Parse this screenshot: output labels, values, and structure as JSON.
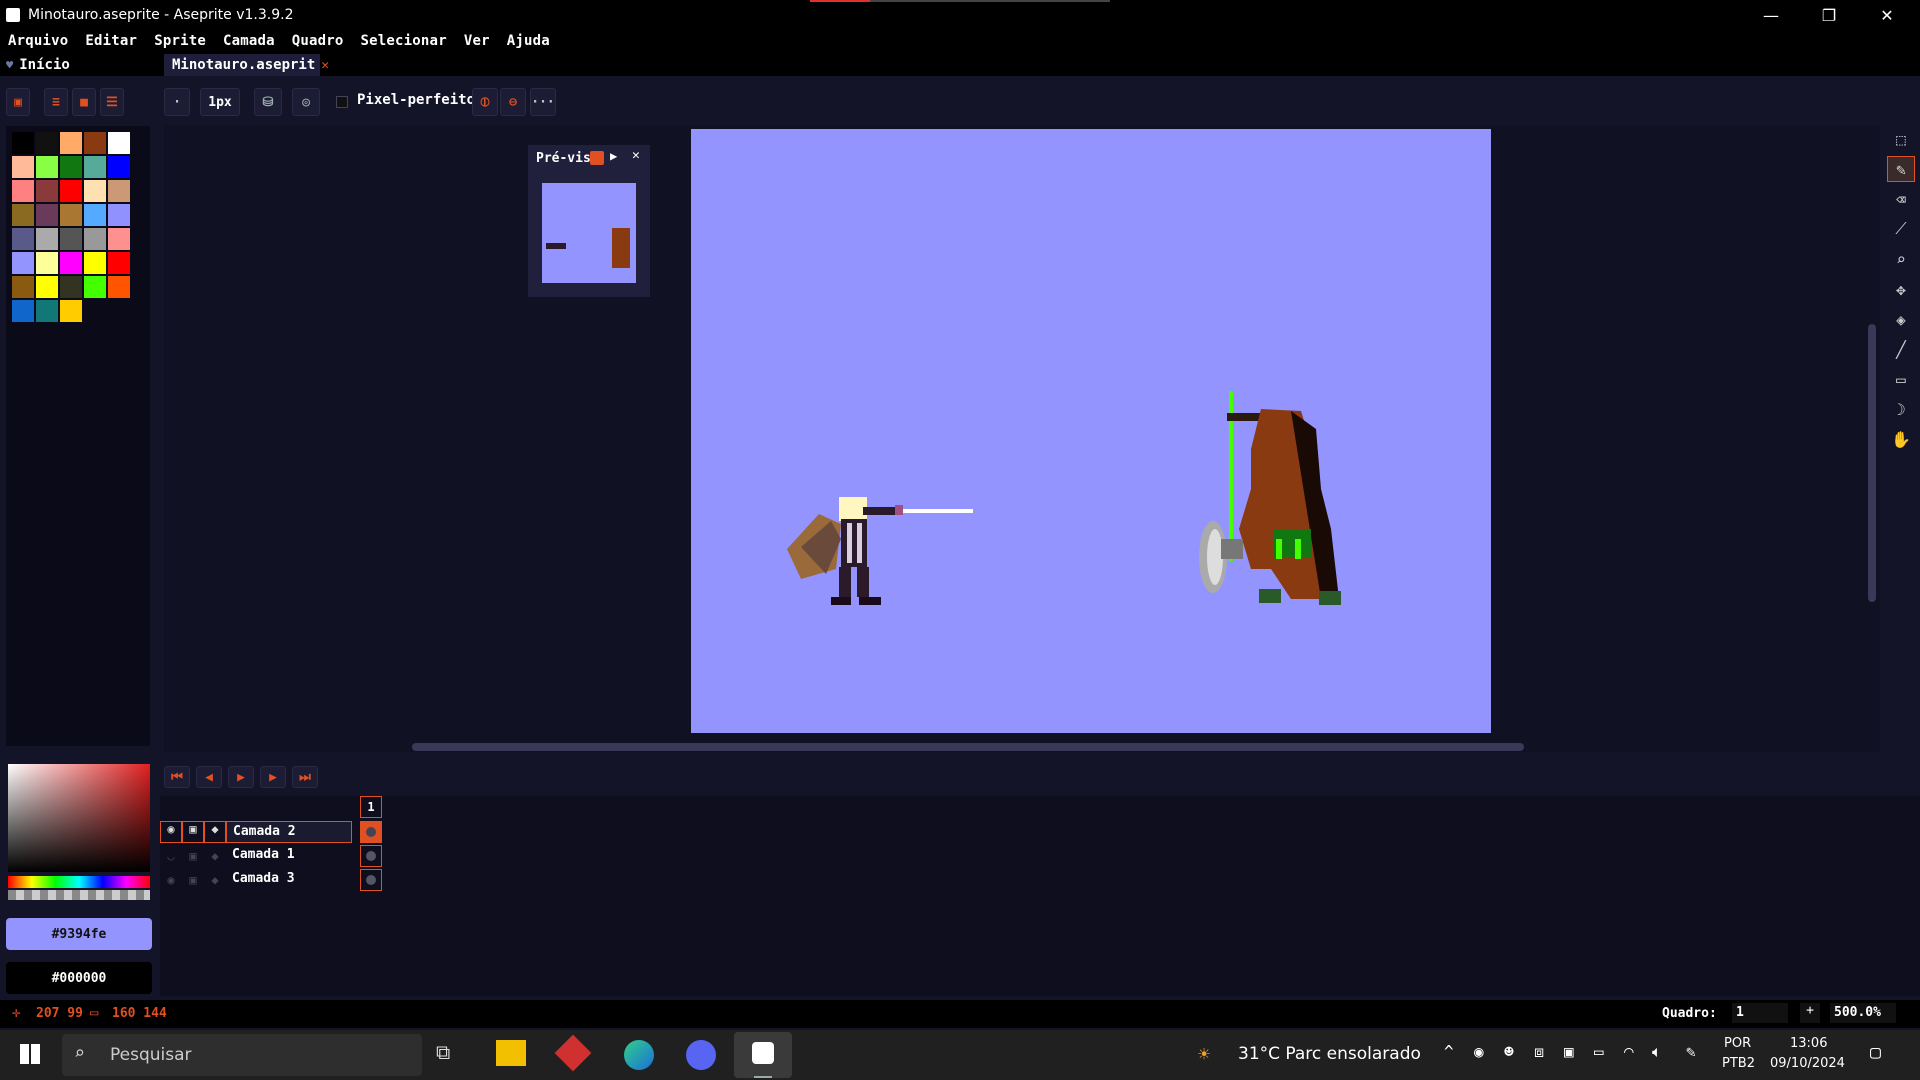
{
  "window": {
    "title": "Minotauro.aseprite - Aseprite v1.3.9.2",
    "minimize": "—",
    "maximize": "❐",
    "close": "✕"
  },
  "menu": [
    "Arquivo",
    "Editar",
    "Sprite",
    "Camada",
    "Quadro",
    "Selecionar",
    "Ver",
    "Ajuda"
  ],
  "tabs": {
    "home": "Início",
    "file": "Minotauro.aseprit",
    "close": "✕"
  },
  "toolbar": {
    "brush_size": "1px",
    "pixel_perfect": "Pixel-perfeito",
    "more": "···"
  },
  "preview": {
    "title": "Pré-vis"
  },
  "colors": {
    "foreground_hex": "#9394fe",
    "background_hex": "#000000",
    "accent": "#e05020",
    "sprite_bg": "#9394fe"
  },
  "palette": [
    "#000000",
    "#111111",
    "#ffaa66",
    "#8a3a10",
    "#ffffff",
    "#ffbb99",
    "#88ff44",
    "#117711",
    "#55aa99",
    "#0000ff",
    "#ff8080",
    "#8a3a3a",
    "#ff0000",
    "#ffe0b0",
    "#cc9977",
    "#8a6a20",
    "#6a3a5a",
    "#aa7733",
    "#55aaff",
    "#9090ff",
    "#5a5a8a",
    "#aaaaaa",
    "#555555",
    "#999999",
    "#ff9090",
    "#9394fe",
    "#ffff99",
    "#ff00ff",
    "#ffff00",
    "#ff0000",
    "#8a5a10",
    "#ffff00",
    "#333322",
    "#44ff00",
    "#ff5500",
    "#1166cc",
    "#117777",
    "#ffcc00"
  ],
  "timeline": {
    "frame_number": "1",
    "layers": [
      {
        "name": "Camada 2",
        "visible": true,
        "selected": true
      },
      {
        "name": "Camada 1",
        "visible": false,
        "selected": false
      },
      {
        "name": "Camada 3",
        "visible": true,
        "selected": false
      }
    ]
  },
  "status": {
    "cursor": "207 99",
    "selection": "160 144",
    "frame_label": "Quadro:",
    "frame_value": "1",
    "plus": "+",
    "zoom": "500.0%"
  },
  "taskbar": {
    "search": "Pesquisar",
    "weather": "31°C  Parc ensolarado",
    "lang1": "POR",
    "lang2": "PTB2",
    "time": "13:06",
    "date": "09/10/2024"
  }
}
